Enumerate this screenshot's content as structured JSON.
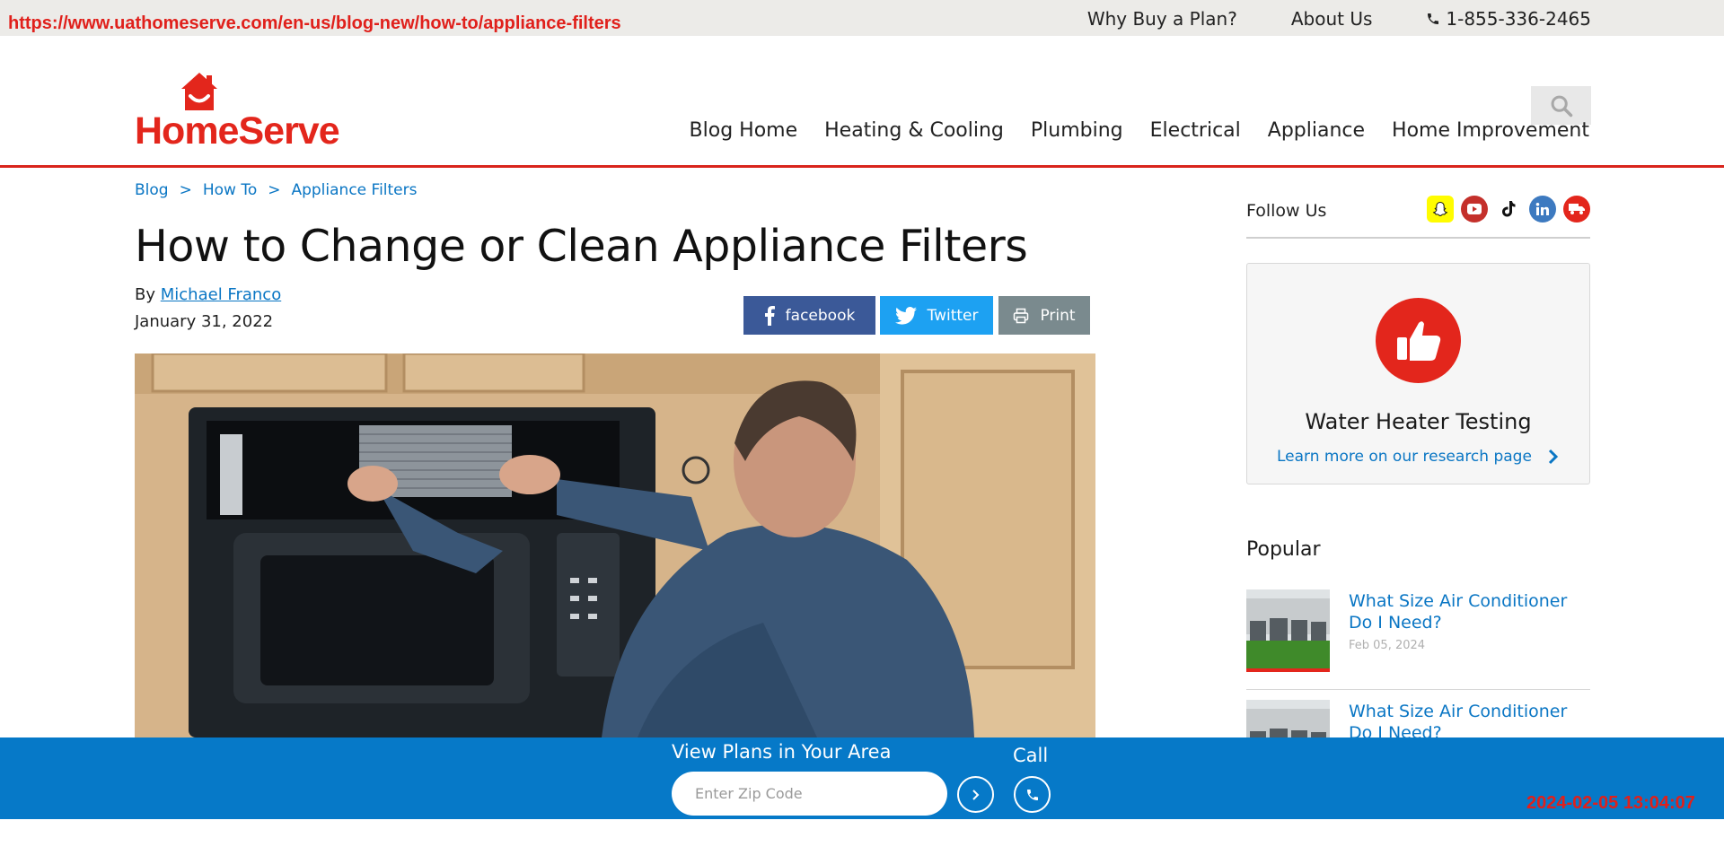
{
  "overlay": {
    "url": "https://www.uathomeserve.com/en-us/blog-new/how-to/appliance-filters",
    "timestamp": "2024-02-05 13:04:07"
  },
  "utility_nav": {
    "items": [
      "Why Buy a Plan?",
      "About Us"
    ],
    "phone": "1-855-336-2465"
  },
  "brand": {
    "logo_text": "HomeServe",
    "accent": "#e3261c"
  },
  "main_nav": [
    "Blog Home",
    "Heating & Cooling",
    "Plumbing",
    "Electrical",
    "Appliance",
    "Home Improvement"
  ],
  "breadcrumb": [
    ">",
    "Blog",
    "How To",
    "Appliance Filters"
  ],
  "article": {
    "title": "How to Change or Clean Appliance Filters",
    "by_prefix": "By",
    "author": "Michael Franco",
    "date": "January 31, 2022"
  },
  "share": {
    "facebook": "facebook",
    "twitter": "Twitter",
    "print": "Print"
  },
  "sidebar": {
    "follow_label": "Follow Us",
    "social_icons": [
      "snapchat-icon",
      "youtube-icon",
      "tiktok-icon",
      "linkedin-icon",
      "truck-icon"
    ],
    "promo": {
      "title": "Water Heater Testing",
      "link": "Learn more on our research page"
    },
    "popular_heading": "Popular",
    "popular": [
      {
        "title": "What Size Air Conditioner Do I Need?",
        "date": "Feb 05, 2024"
      },
      {
        "title": "What Size Air Conditioner Do I Need?",
        "date": ""
      }
    ]
  },
  "plans_bar": {
    "label": "View Plans in Your Area",
    "zip_placeholder": "Enter Zip Code",
    "call_label": "Call",
    "color": "#0679c8"
  }
}
